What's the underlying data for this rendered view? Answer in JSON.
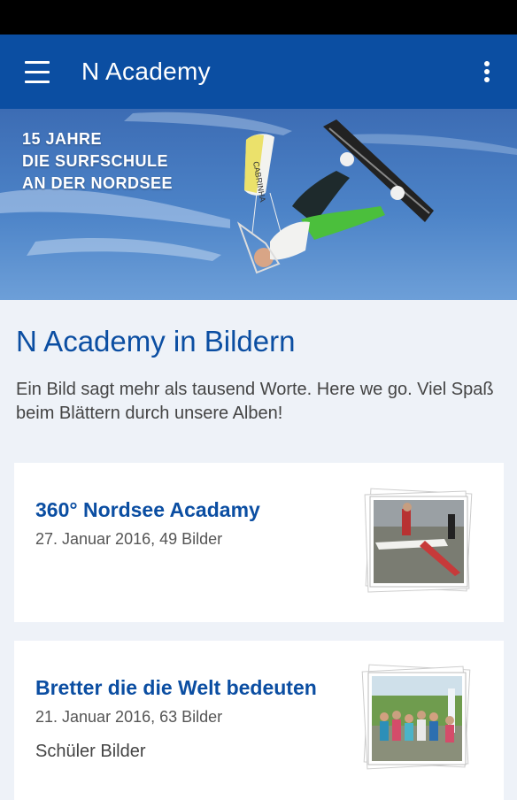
{
  "appbar": {
    "title": "N Academy"
  },
  "hero": {
    "lines": [
      "15 JAHRE",
      "DIE SURFSCHULE",
      "AN DER NORDSEE"
    ],
    "kite_brand": "CABRINHA"
  },
  "section": {
    "title": "N Academy in Bildern",
    "intro": "Ein Bild sagt mehr als tausend Worte. Here we go. Viel Spaß beim Blättern durch unsere Alben!"
  },
  "albums": [
    {
      "title": "360° Nordsee Acadamy",
      "meta": "27. Januar 2016, 49 Bilder",
      "description": ""
    },
    {
      "title": "Bretter die die Welt bedeuten",
      "meta": "21. Januar 2016, 63 Bilder",
      "description": "Schüler Bilder"
    }
  ],
  "colors": {
    "primary": "#0b4ea2",
    "background": "#eef2f8",
    "card": "#ffffff"
  },
  "icons": {
    "menu": "hamburger-menu-icon",
    "overflow": "more-vert-icon"
  }
}
